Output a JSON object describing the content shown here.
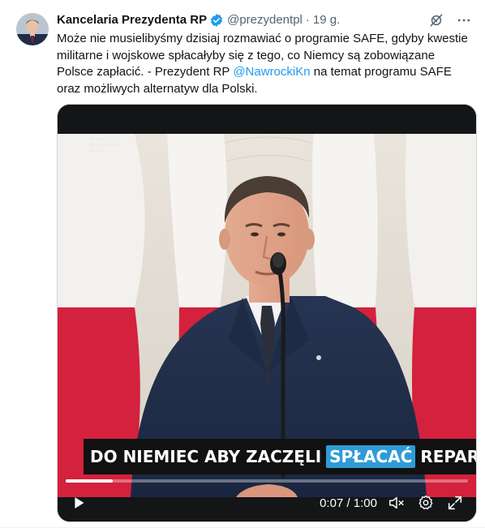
{
  "author": {
    "name": "Kancelaria Prezydenta RP",
    "handle": "@prezydentpl",
    "separator": "·",
    "time": "19 g."
  },
  "tweet": {
    "line1": "Może nie musielibyśmy dzisiaj rozmawiać o programie SAFE, gdyby kwestie",
    "line2": "militarne i wojskowe spłacałyby się z tego, co Niemcy są zobowiązane",
    "line3_pre": "Polsce zapłacić. - Prezydent RP ",
    "mention": "@NawrockiKn",
    "line3_post": " na temat programu SAFE",
    "line4": "oraz możliwych alternatyw dla Polski."
  },
  "video": {
    "logo_mark": "RP",
    "logo_text_1": "Prezydent",
    "logo_text_2": "Rzeczypospolitej",
    "logo_text_3": "Polskiej",
    "subtitle_pre": "DO NIEMIEC ABY ZACZĘLI",
    "subtitle_highlight": "SPŁACAĆ",
    "subtitle_post": "REPARACJE",
    "current_time": "0:07",
    "duration": "1:00",
    "time_display": "0:07 / 1:00",
    "progress_fraction": 0.117
  },
  "icons": {
    "header": [
      "grok-icon",
      "more-icon"
    ],
    "controls": [
      "play-icon",
      "mute-icon",
      "settings-icon",
      "fullscreen-icon"
    ]
  },
  "colors": {
    "accent": "#1d9bf0",
    "subtitle_highlight": "#2f9bd6",
    "flag_red": "#d4213d",
    "text": "#0f1419",
    "secondary": "#536471"
  }
}
